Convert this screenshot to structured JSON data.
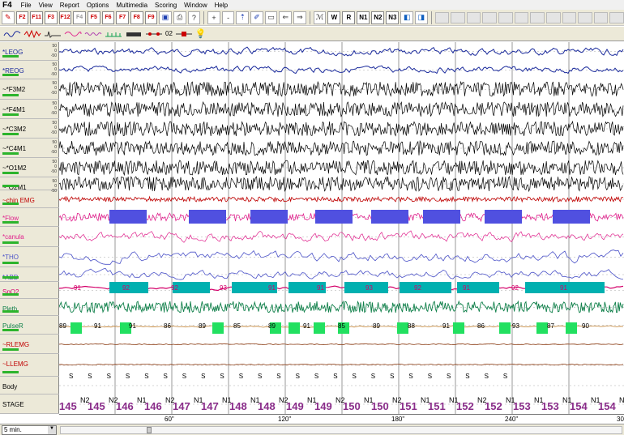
{
  "app": {
    "title": "F4"
  },
  "menu": [
    "File",
    "View",
    "Report",
    "Options",
    "Multimedia",
    "Scoring",
    "Window",
    "Help"
  ],
  "toolbar": {
    "fkeys": [
      "F2",
      "F11",
      "F3",
      "F12",
      "F4",
      "F5",
      "F6",
      "F7",
      "F8",
      "F9"
    ],
    "stages": [
      "W",
      "R",
      "N1",
      "N2",
      "N3"
    ]
  },
  "toolbar2": {
    "zoom_label": "02"
  },
  "channels": [
    {
      "name": "*LEOG"
    },
    {
      "name": "*REOG"
    },
    {
      "name": "~*F3M2"
    },
    {
      "name": "~*F4M1"
    },
    {
      "name": "~*C3M2"
    },
    {
      "name": "~*C4M1"
    },
    {
      "name": "~*O1M2"
    },
    {
      "name": "~*O2M1"
    },
    {
      "name": "~chin EMG"
    },
    {
      "name": "*Flow"
    },
    {
      "name": "*canula"
    },
    {
      "name": "*THO"
    },
    {
      "name": "*ABD"
    },
    {
      "name": "SpO2"
    },
    {
      "name": "Pleth"
    },
    {
      "name": "PulseR"
    },
    {
      "name": "~RLEMG"
    },
    {
      "name": "~LLEMG"
    },
    {
      "name": "Body"
    },
    {
      "name": "STAGE"
    }
  ],
  "scale_labels": [
    "50",
    "0",
    "-50"
  ],
  "spo2_values": [
    "91",
    "92",
    "92",
    "93",
    "91",
    "91",
    "93",
    "92",
    "91",
    "92",
    "91"
  ],
  "pulse_values": [
    "89",
    "91",
    "91",
    "86",
    "89",
    "85",
    "89",
    "91",
    "85",
    "89",
    "88",
    "91",
    "86",
    "93",
    "87",
    "90"
  ],
  "body": "S",
  "stages_row": [
    "N2",
    "N2",
    "N1",
    "N2",
    "N1",
    "N1",
    "N1",
    "N2",
    "N1",
    "N2",
    "N1",
    "N2",
    "N1",
    "N1",
    "N2",
    "N1",
    "N1",
    "N1",
    "N1",
    "N1"
  ],
  "epochs": [
    "145",
    "145",
    "146",
    "146",
    "147",
    "147",
    "148",
    "148",
    "149",
    "149",
    "150",
    "150",
    "151",
    "151",
    "152",
    "152",
    "153",
    "153",
    "154",
    "154"
  ],
  "time_axis": [
    "60\"",
    "120\"",
    "180\"",
    "240\"",
    "30"
  ],
  "status": {
    "time_window": "5 min."
  },
  "colors": {
    "eog": "#1a2a9c",
    "eeg": "#000000",
    "emg": "#c00000",
    "flow": "#e0208c",
    "resp": "#4b52c8",
    "spo2": "#d4006a",
    "desat": "#00b0b0",
    "pleth": "#10804a",
    "pulse_bar": "#22e060",
    "apnea": "#5050e0"
  }
}
